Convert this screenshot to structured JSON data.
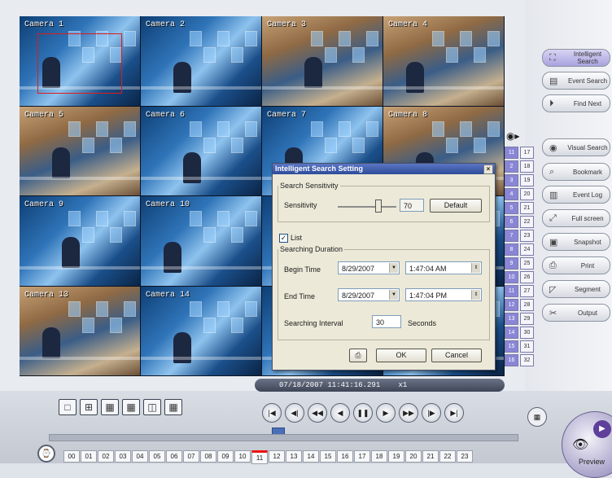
{
  "cameras": [
    {
      "label": "Camera 1",
      "style": "a"
    },
    {
      "label": "Camera 2",
      "style": "a"
    },
    {
      "label": "Camera 3",
      "style": "b"
    },
    {
      "label": "Camera 4",
      "style": "b"
    },
    {
      "label": "Camera 5",
      "style": "b"
    },
    {
      "label": "Camera 6",
      "style": "a"
    },
    {
      "label": "Camera 7",
      "style": "a"
    },
    {
      "label": "Camera 8",
      "style": "b"
    },
    {
      "label": "Camera 9",
      "style": "a"
    },
    {
      "label": "Camera 10",
      "style": "a"
    },
    {
      "label": "",
      "style": "a"
    },
    {
      "label": "",
      "style": "a"
    },
    {
      "label": "Camera 13",
      "style": "b"
    },
    {
      "label": "Camera 14",
      "style": "a"
    },
    {
      "label": "",
      "style": "a"
    },
    {
      "label": "",
      "style": "a"
    }
  ],
  "status_bar": {
    "datetime": "07/18/2007 11:41:16.291",
    "speed": "x1"
  },
  "channels": [
    [
      "11",
      "17"
    ],
    [
      "2",
      "18"
    ],
    [
      "3",
      "19"
    ],
    [
      "4",
      "20"
    ],
    [
      "5",
      "21"
    ],
    [
      "6",
      "22"
    ],
    [
      "7",
      "23"
    ],
    [
      "8",
      "24"
    ],
    [
      "9",
      "25"
    ],
    [
      "10",
      "26"
    ],
    [
      "11",
      "27"
    ],
    [
      "12",
      "28"
    ],
    [
      "13",
      "29"
    ],
    [
      "14",
      "30"
    ],
    [
      "15",
      "31"
    ],
    [
      "16",
      "32"
    ]
  ],
  "right_buttons": {
    "intelligent_search": "Intelligent Search",
    "event_search": "Event Search",
    "find_next": "Find Next",
    "visual_search": "Visual Search",
    "bookmark": "Bookmark",
    "event_log": "Event Log",
    "full_screen": "Full screen",
    "snapshot": "Snapshot",
    "print": "Print",
    "segment": "Segment",
    "output": "Output"
  },
  "preview_label": "Preview",
  "hours": [
    "00",
    "01",
    "02",
    "03",
    "04",
    "05",
    "06",
    "07",
    "08",
    "09",
    "10",
    "11",
    "12",
    "13",
    "14",
    "15",
    "16",
    "17",
    "18",
    "19",
    "20",
    "21",
    "22",
    "23"
  ],
  "current_hour": "11",
  "dialog": {
    "title": "Intelligent Search Setting",
    "close": "×",
    "sensitivity_group": "Search Sensitivity",
    "sensitivity_label": "Sensitivity",
    "sensitivity_value": "70",
    "default_button": "Default",
    "list_label": "List",
    "list_checked": "✓",
    "duration_group": "Searching Duration",
    "begin_label": "Begin Time",
    "begin_date": "8/29/2007",
    "begin_time": "1:47:04 AM",
    "end_label": "End Time",
    "end_date": "8/29/2007",
    "end_time": "1:47:04 PM",
    "interval_label": "Searching Interval",
    "interval_value": "30",
    "interval_unit": "Seconds",
    "ok": "OK",
    "cancel": "Cancel"
  },
  "colors": {
    "accent": "#2d4b9a",
    "selection": "#e01b1b",
    "channel_on": "#8a86d6"
  }
}
